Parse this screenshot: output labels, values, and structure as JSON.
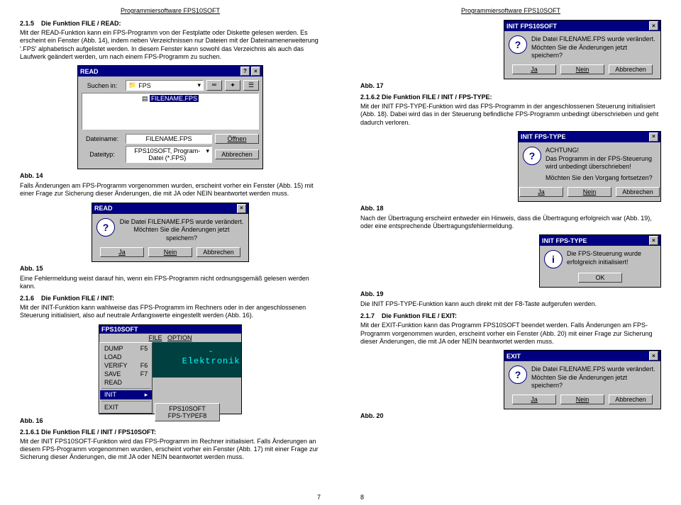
{
  "running_header": "Programmiersoftware FPS10SOFT",
  "left": {
    "sec_215_num": "2.1.5",
    "sec_215_title": "Die Funktion FILE / READ:",
    "p215": "Mit der READ-Funktion kann ein FPS-Programm von der Festplatte oder Diskette gelesen werden. Es erscheint ein Fenster (Abb. 14), indem neben Verzeichnissen nur Dateien mit der Dateinamenerweiterung '.FPS' alphabetisch aufgelistet werden. In diesem Fenster kann sowohl das Verzeichnis als auch das Laufwerk geändert werden, um nach einem FPS-Programm zu suchen.",
    "read": {
      "title": "READ",
      "lbl_suchen": "Suchen in:",
      "dir": "FPS",
      "listitem": "FILENAME.FPS",
      "lbl_dateiname": "Dateiname:",
      "val_dateiname": "FILENAME.FPS",
      "lbl_dateityp": "Dateityp:",
      "val_dateityp": "FPS10SOFT, Program-Datei (*.FPS)",
      "btn_open": "Öffnen",
      "btn_cancel": "Abbrechen"
    },
    "cap14": "Abb. 14",
    "p14": "Falls Änderungen am FPS-Programm vorgenommen wurden, erscheint vorher ein Fenster (Abb. 15) mit einer Frage zur Sicherung dieser Änderungen, die mit JA oder NEIN beantwortet werden muss.",
    "dlg15": {
      "title": "READ",
      "line1": "Die Datei FILENAME.FPS wurde verändert.",
      "line2": "Möchten Sie die Änderungen jetzt speichern?",
      "ja": "Ja",
      "nein": "Nein",
      "abbr": "Abbrechen"
    },
    "cap15": "Abb. 15",
    "p15": "Eine Fehlermeldung weist darauf hin, wenn ein FPS-Programm nicht ordnungsgemäß gelesen werden kann.",
    "sec_216_num": "2.1.6",
    "sec_216_title": "Die Funktion FILE / INIT:",
    "p216": "Mit der INIT-Funktion kann wahlweise das FPS-Programm im Rechners oder in der angeschlossenen Steuerung initialisiert, also auf neutrale Anfangswerte eingestellt werden (Abb. 16).",
    "app": {
      "title": "FPS10SOFT",
      "menu_file": "FILE",
      "menu_option": "OPTION",
      "m_dump": "DUMP",
      "k_dump": "F5",
      "m_load": "LOAD",
      "m_verify": "VERIFY",
      "k_verify": "F6",
      "m_save": "SAVE",
      "k_save": "F7",
      "m_read": "READ",
      "m_init": "INIT",
      "m_exit": "EXIT",
      "sub1": "FPS10SOFT",
      "sub2": "FPS-TYPE",
      "sub2k": "F8",
      "brand": "-Elektronik"
    },
    "cap16": "Abb. 16",
    "sec_2161": "2.1.6.1  Die Funktion FILE / INIT / FPS10SOFT:",
    "p2161": "Mit der INIT FPS10SOFT-Funktion wird das FPS-Programm im Rechner initialisiert. Falls Änderungen an diesem FPS-Programm vorgenommen wurden, erscheint vorher ein Fenster (Abb. 17) mit einer Frage zur Sicherung dieser Änderungen, die mit JA oder NEIN beantwortet werden muss.",
    "pagenum": "7"
  },
  "right": {
    "dlg17": {
      "title": "INIT FPS10SOFT",
      "line1": "Die Datei FILENAME.FPS wurde verändert.",
      "line2": "Möchten Sie die Änderungen jetzt speichern?",
      "ja": "Ja",
      "nein": "Nein",
      "abbr": "Abbrechen"
    },
    "cap17": "Abb. 17",
    "sec_2162": "2.1.6.2  Die Funktion FILE / INIT / FPS-TYPE:",
    "p2162": "Mit der INIT FPS-TYPE-Funktion wird das FPS-Programm in der angeschlossenen Steuerung initialisiert (Abb. 18). Dabei wird das in der Steuerung befindliche FPS-Programm unbedingt überschrieben und geht dadurch verloren.",
    "dlg18": {
      "title": "INIT FPS-TYPE",
      "line1": "ACHTUNG!",
      "line2": "Das Programm in der FPS-Steuerung wird unbedingt überschrieben!",
      "line3": "Möchten Sie den Vorgang fortsetzen?",
      "ja": "Ja",
      "nein": "Nein",
      "abbr": "Abbrechen"
    },
    "cap18": "Abb. 18",
    "p18": "Nach der Übertragung erscheint entweder ein Hinweis, dass die Übertragung erfolgreich war (Abb. 19), oder eine entsprechende Übertragungsfehlermeldung.",
    "dlg19": {
      "title": "INIT FPS-TYPE",
      "line1": "Die FPS-Steuerung wurde erfolgreich initialisiert!",
      "ok": "OK"
    },
    "cap19": "Abb. 19",
    "p19": "Die INIT FPS-TYPE-Funktion kann auch direkt mit der F8-Taste aufgerufen werden.",
    "sec_217_num": "2.1.7",
    "sec_217_title": "Die Funktion FILE / EXIT:",
    "p217": "Mit der EXIT-Funktion kann das Programm FPS10SOFT beendet werden. Falls Änderungen am FPS-Programm vorgenommen wurden, erscheint vorher ein Fenster (Abb. 20) mit einer Frage zur Sicherung dieser Änderungen, die mit JA oder NEIN beantwortet werden muss.",
    "dlg20": {
      "title": "EXIT",
      "line1": "Die Datei FILENAME.FPS wurde verändert.",
      "line2": "Möchten Sie die Änderungen jetzt speichern?",
      "ja": "Ja",
      "nein": "Nein",
      "abbr": "Abbrechen"
    },
    "cap20": "Abb. 20",
    "pagenum": "8"
  }
}
